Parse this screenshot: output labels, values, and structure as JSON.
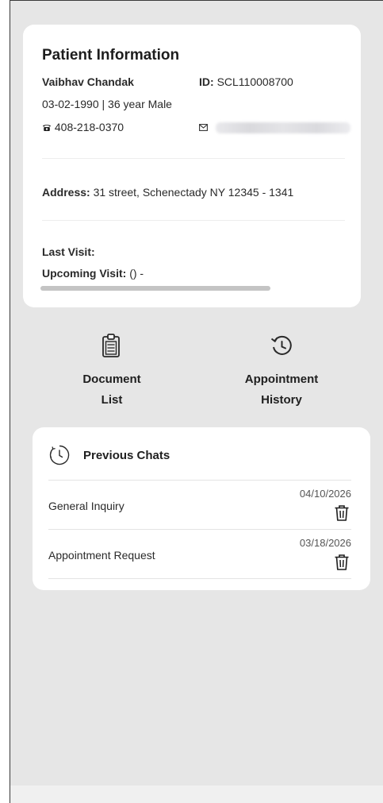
{
  "patient": {
    "title": "Patient Information",
    "name": "Vaibhav Chandak",
    "id_label": "ID:",
    "id_value": "SCL110008700",
    "dob_line": "03-02-1990 | 36 year Male",
    "phone": "408-218-0370",
    "address_label": "Address:",
    "address_value": "31 street, Schenectady NY 12345 - 1341",
    "last_visit_label": "Last Visit:",
    "last_visit_value": "",
    "upcoming_visit_label": "Upcoming Visit:",
    "upcoming_visit_value": "() -"
  },
  "actions": {
    "document": {
      "line1": "Document",
      "line2": "List",
      "icon": "clipboard-list-icon"
    },
    "appointment": {
      "line1": "Appointment",
      "line2": "History",
      "icon": "history-icon"
    }
  },
  "chats": {
    "title": "Previous Chats",
    "items": [
      {
        "name": "General Inquiry",
        "date": "04/10/2026"
      },
      {
        "name": "Appointment Request",
        "date": "03/18/2026"
      }
    ]
  },
  "colors": {
    "background": "#e6e6e6",
    "card": "#ffffff",
    "text": "#1f1f1f"
  }
}
